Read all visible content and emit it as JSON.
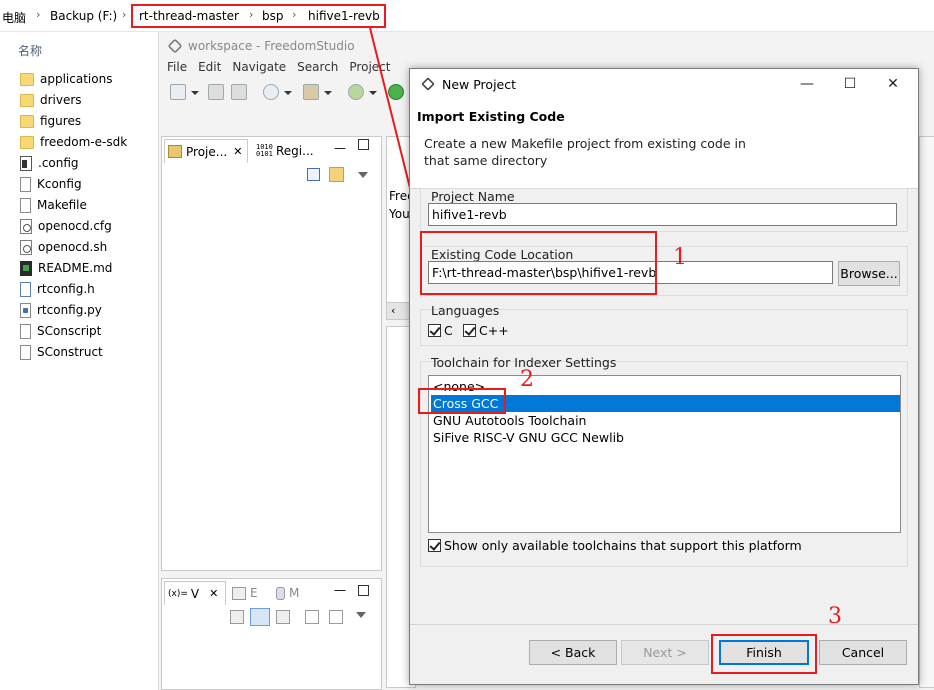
{
  "explorer": {
    "breadcrumb": [
      "电脑",
      "Backup (F:)",
      "rt-thread-master",
      "bsp",
      "hifive1-revb"
    ],
    "column_header": "名称",
    "files": [
      {
        "name": "applications",
        "icon": "folder-icon"
      },
      {
        "name": "drivers",
        "icon": "folder-icon"
      },
      {
        "name": "figures",
        "icon": "folder-icon"
      },
      {
        "name": "freedom-e-sdk",
        "icon": "folder-icon"
      },
      {
        "name": ".config",
        "icon": "config-file-icon"
      },
      {
        "name": "Kconfig",
        "icon": "file-icon"
      },
      {
        "name": "Makefile",
        "icon": "file-icon"
      },
      {
        "name": "openocd.cfg",
        "icon": "gear-file-icon"
      },
      {
        "name": "openocd.sh",
        "icon": "gear-file-icon"
      },
      {
        "name": "README.md",
        "icon": "markdown-file-icon"
      },
      {
        "name": "rtconfig.h",
        "icon": "header-file-icon"
      },
      {
        "name": "rtconfig.py",
        "icon": "python-file-icon"
      },
      {
        "name": "SConscript",
        "icon": "file-icon"
      },
      {
        "name": "SConstruct",
        "icon": "file-icon"
      }
    ]
  },
  "eclipse": {
    "title": "workspace - FreedomStudio",
    "menu": [
      "File",
      "Edit",
      "Navigate",
      "Search",
      "Project"
    ],
    "tabs": {
      "project": "Proje...",
      "registers": "Regi...",
      "variables": "V",
      "expressions": "E",
      "modules": "M"
    },
    "partial_texts": {
      "free": "Free",
      "you": "You"
    }
  },
  "dialog": {
    "title": "New Project",
    "heading": "Import Existing Code",
    "description": "Create a new Makefile project from existing code in that same directory",
    "project_name_label": "Project Name",
    "project_name_value": "hifive1-revb",
    "location_label": "Existing Code Location",
    "location_value": "F:\\rt-thread-master\\bsp\\hifive1-revb",
    "browse_label": "Browse...",
    "languages_label": "Languages",
    "lang_c": "C",
    "lang_cpp": "C++",
    "toolchain_label": "Toolchain for Indexer Settings",
    "toolchains": [
      "<none>",
      "Cross GCC",
      "GNU Autotools Toolchain",
      "SiFive RISC-V GNU GCC Newlib"
    ],
    "selected_toolchain": "Cross GCC",
    "show_only_label": "Show only available toolchains that support this platform",
    "buttons": {
      "back": "< Back",
      "next": "Next >",
      "finish": "Finish",
      "cancel": "Cancel"
    }
  },
  "annotations": {
    "one": "1",
    "two": "2",
    "three": "3"
  },
  "colors": {
    "annotation": "#e81c1c",
    "selection": "#0078d7"
  }
}
